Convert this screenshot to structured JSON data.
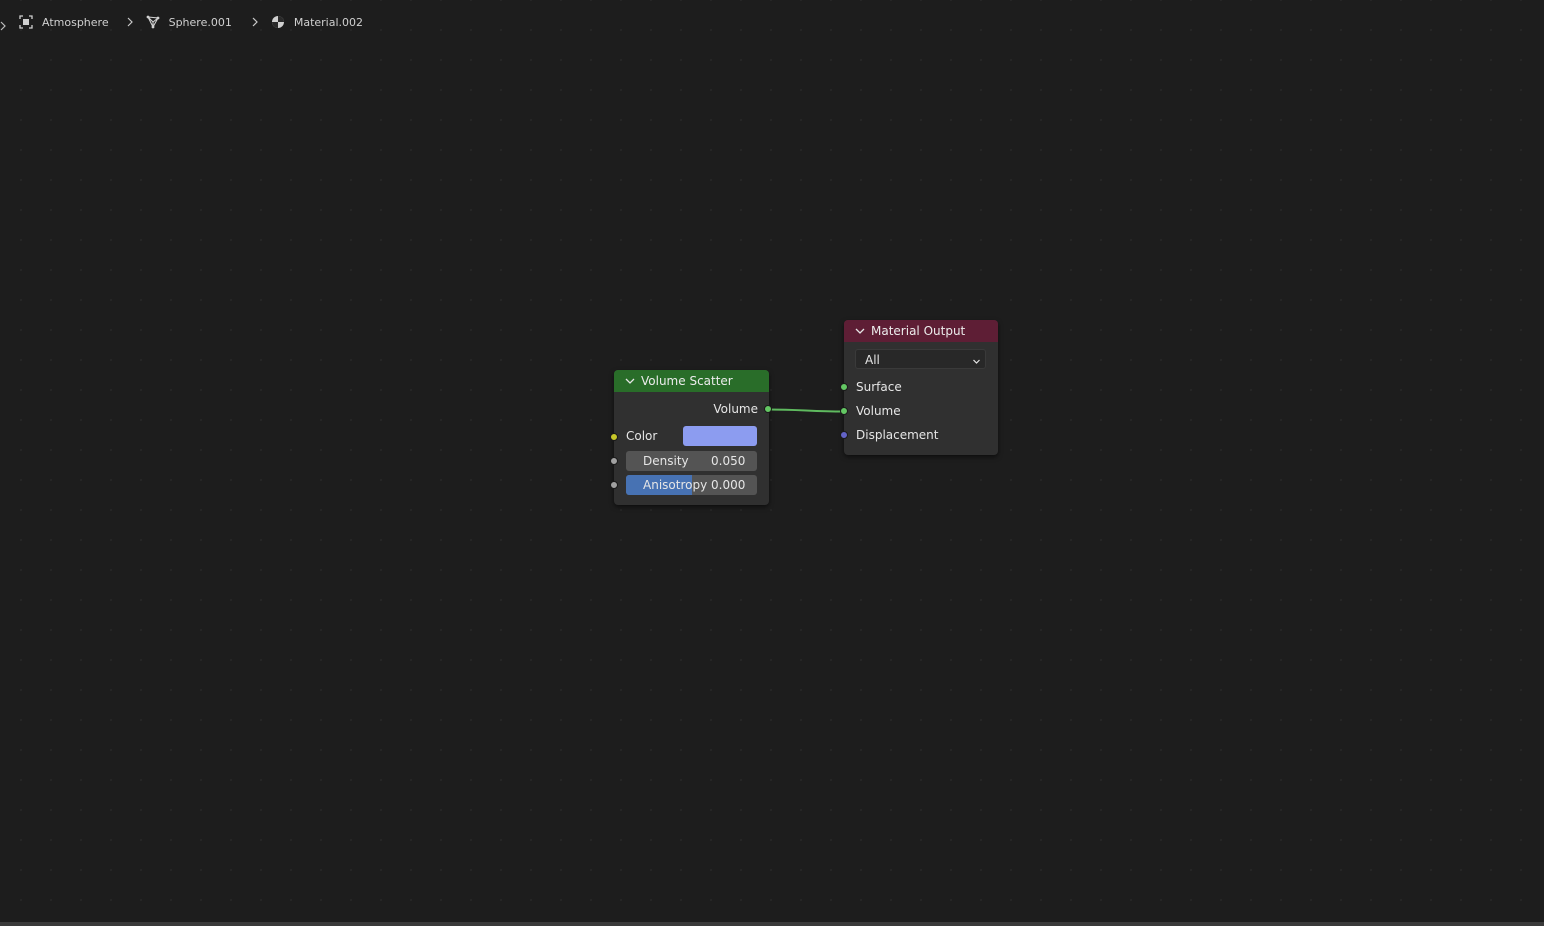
{
  "breadcrumb": {
    "items": [
      {
        "label": "Atmosphere",
        "icon": "object-icon"
      },
      {
        "label": "Sphere.001",
        "icon": "mesh-icon"
      },
      {
        "label": "Material.002",
        "icon": "material-icon"
      }
    ]
  },
  "nodes": {
    "volume_scatter": {
      "title": "Volume Scatter",
      "output_volume": "Volume",
      "color_label": "Color",
      "color_value": "#8c9cf0",
      "density_label": "Density",
      "density_value": "0.050",
      "anisotropy_label": "Anisotropy",
      "anisotropy_value": "0.000",
      "anisotropy_fill": 0.5,
      "header_color": "#296d29"
    },
    "material_output": {
      "title": "Material Output",
      "target_selected": "All",
      "surface_label": "Surface",
      "volume_label": "Volume",
      "displacement_label": "Displacement",
      "header_color": "#5e1e35"
    }
  },
  "colors": {
    "shader_socket": "#63c763",
    "color_socket": "#c7c729",
    "float_socket": "#a1a1a1",
    "vector_socket": "#6363c7",
    "link": "#5fba5f"
  }
}
